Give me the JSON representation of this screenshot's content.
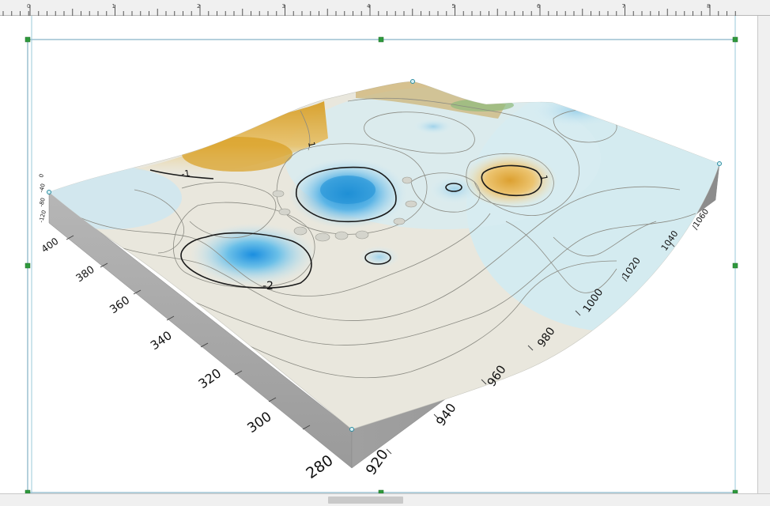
{
  "ruler": {
    "labels": [
      "0",
      "1",
      "2",
      "3",
      "4",
      "5",
      "6",
      "7",
      "8"
    ]
  },
  "plot": {
    "left_axis_ticks": [
      "280",
      "300",
      "320",
      "340",
      "360",
      "380",
      "400"
    ],
    "right_axis_ticks": [
      "920",
      "940",
      "960",
      "980",
      "1000",
      "1020",
      "1040",
      "1060"
    ],
    "z_axis_ticks": [
      "0",
      "-40",
      "-80",
      "-120"
    ],
    "contour_labels": [
      "-2",
      "-1",
      "1",
      "1"
    ]
  },
  "colors": {
    "selection_frame": "#6aa0b8",
    "handle": "#2e9a3c",
    "block_side": "#a8a8a8",
    "low_blue": "#1f8fd6",
    "high_orange": "#e0a020"
  }
}
